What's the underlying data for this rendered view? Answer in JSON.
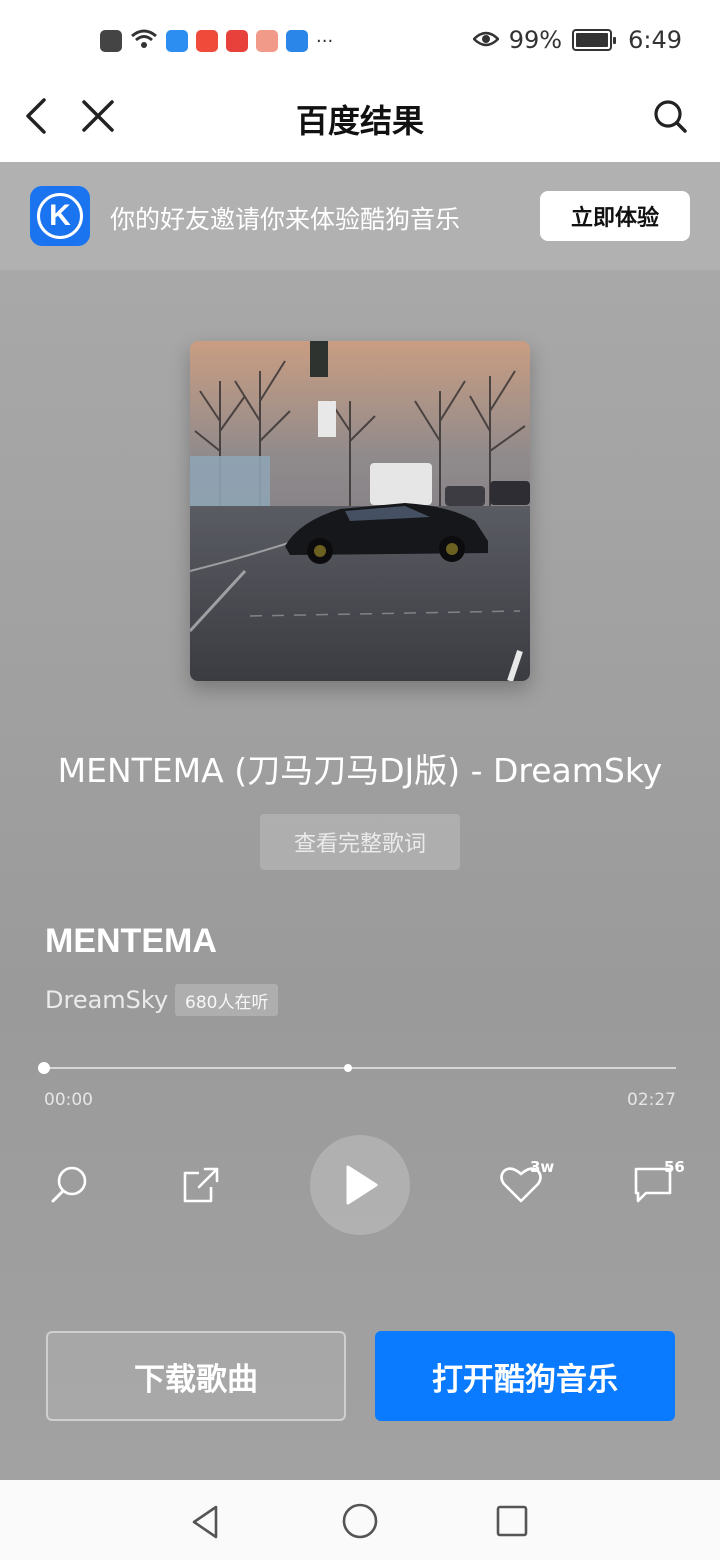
{
  "status_bar": {
    "battery": "99%",
    "time": "6:49",
    "more": "···",
    "battery_level": 0.99
  },
  "nav": {
    "title": "百度结果"
  },
  "banner": {
    "text": "你的好友邀请你来体验酷狗音乐",
    "button": "立即体验",
    "logo_letter": "K"
  },
  "song": {
    "full_title": "MENTEMA (刀马刀马DJ版) - DreamSky",
    "lyrics_button": "查看完整歌词",
    "name": "MENTEMA",
    "artist": "DreamSky",
    "listeners": "680人在听"
  },
  "progress": {
    "current": "00:00",
    "total": "02:27",
    "fraction": 0.0
  },
  "controls": {
    "like_count": "3w",
    "comment_count": "56"
  },
  "actions": {
    "download": "下载歌曲",
    "open_app": "打开酷狗音乐"
  }
}
